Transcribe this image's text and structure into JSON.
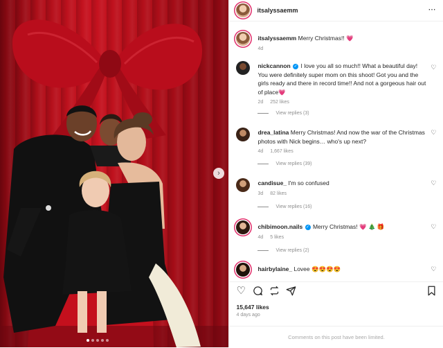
{
  "post": {
    "username": "itsalyssaemm",
    "more_icon": "⋯",
    "next_icon": "›",
    "media_dots": 5,
    "media_active_dot": 0
  },
  "comments": [
    {
      "user": "itsalyssaemm",
      "verified": false,
      "text": "Merry Christmas!! 💗",
      "time": "4d",
      "likes": "",
      "reply": "",
      "like_button": false
    },
    {
      "user": "nickcannon",
      "verified": true,
      "text": "I love you all so much!! What a beautiful day! You were definitely super mom on this shoot! Got you and the girls ready and there in record time!! And not a gorgeous hair out of place💗",
      "time": "2d",
      "likes": "252 likes",
      "reply": "View replies (3)",
      "like_button": true
    },
    {
      "user": "drea_latina",
      "verified": false,
      "text": "Merry Christmas! And now the war of the Christmas photos with Nick begins… who's up next?",
      "time": "4d",
      "likes": "1,667 likes",
      "reply": "View replies (39)",
      "like_button": true
    },
    {
      "user": "candisue_",
      "verified": false,
      "text": "I'm so confused",
      "time": "3d",
      "likes": "82 likes",
      "reply": "View replies (16)",
      "like_button": true
    },
    {
      "user": "chibimoon.nails",
      "verified": true,
      "text": "Merry Christmas! 💗 🎄 🎁",
      "time": "4d",
      "likes": "5 likes",
      "reply": "View replies (2)",
      "like_button": true
    },
    {
      "user": "hairbylaine_",
      "verified": false,
      "text": "Lovee 😍😍😍😍",
      "time": "",
      "likes": "",
      "reply": "",
      "like_button": true
    }
  ],
  "actions": {
    "like_icon": "♡",
    "comment_icon": "comment-icon",
    "share_icon": "share-icon",
    "save_icon": "bookmark-icon"
  },
  "likes_count": "15,647 likes",
  "posted_ago": "4 days ago",
  "comments_limited": "Comments on this post have been limited.",
  "colors": {
    "accent": "#0095f6",
    "ring": "#e1306c",
    "curtain": "#c8121f"
  }
}
